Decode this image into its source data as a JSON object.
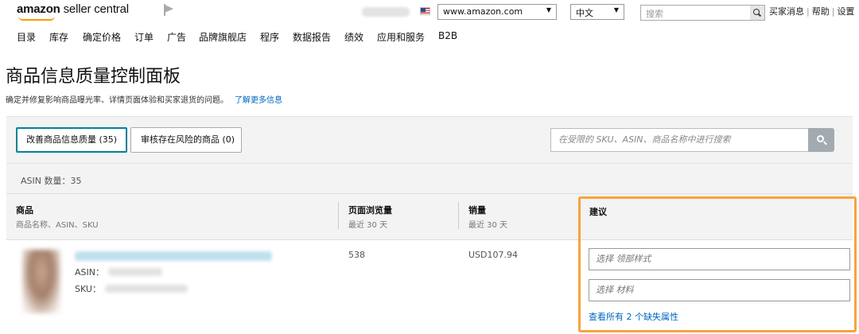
{
  "brand": {
    "logo_bold": "amazon",
    "logo_rest": " seller central"
  },
  "topbar": {
    "marketplace": "www.amazon.com",
    "language": "中文",
    "search_placeholder": "搜索",
    "links": [
      "买家消息",
      "帮助",
      "设置"
    ]
  },
  "nav": [
    "目录",
    "库存",
    "确定价格",
    "订单",
    "广告",
    "品牌旗舰店",
    "程序",
    "数据报告",
    "绩效",
    "应用和服务",
    "B2B"
  ],
  "page": {
    "title": "商品信息质量控制面板",
    "subtitle": "确定并修复影响商品曝光率、详情页面体验和买家退货的问题。",
    "learn_more": "了解更多信息"
  },
  "tabs": {
    "improve": "改善商品信息质量 (35)",
    "risk": "审核存在风险的商品 (0)"
  },
  "filter": {
    "placeholder": "在受限的 SKU、ASIN、商品名称中进行搜索"
  },
  "asin_count": "ASIN 数量：35",
  "columns": {
    "product": {
      "title": "商品",
      "sub": "商品名称、ASIN、SKU"
    },
    "views": {
      "title": "页面浏览量",
      "sub": "最近 30 天"
    },
    "sales": {
      "title": "销量",
      "sub": "最近 30 天"
    },
    "suggestion": {
      "title": "建议"
    }
  },
  "row": {
    "asin_label": "ASIN：",
    "sku_label": "SKU：",
    "page_views": "538",
    "sales": "USD107.94",
    "select_neckline": "选择 领部样式",
    "select_material": "选择 材料",
    "missing_attrs": "查看所有 2 个缺失属性"
  },
  "colors": {
    "accent_link": "#0066c0",
    "highlight": "#f7a33d",
    "tab_active": "#008296"
  }
}
